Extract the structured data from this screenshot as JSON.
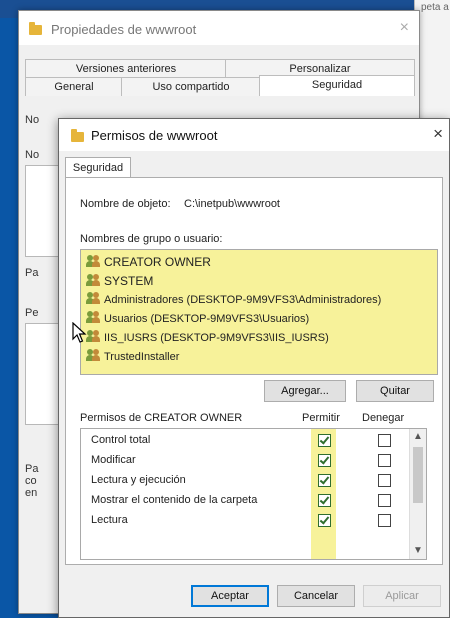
{
  "background": {
    "breadcrumb": "peta a"
  },
  "outer_window": {
    "title": "Propiedades de wwwroot",
    "close_glyph": "×",
    "tabs_row1": [
      "Versiones anteriores",
      "Personalizar"
    ],
    "tabs_row2": [
      "General",
      "Uso compartido",
      "Seguridad"
    ],
    "left_fragments": [
      "No",
      "No",
      "Pa",
      "Pe",
      "Pa",
      "co",
      "en"
    ]
  },
  "dialog": {
    "title": "Permisos de wwwroot",
    "close_glyph": "×",
    "tab": "Seguridad",
    "object_label": "Nombre de objeto:",
    "object_value": "C:\\inetpub\\wwwroot",
    "groups_label": "Nombres de grupo o usuario:",
    "groups": [
      "CREATOR OWNER",
      "SYSTEM",
      "Administradores (DESKTOP-9M9VFS3\\Administradores)",
      "Usuarios (DESKTOP-9M9VFS3\\Usuarios)",
      "IIS_IUSRS (DESKTOP-9M9VFS3\\IIS_IUSRS)",
      "TrustedInstaller"
    ],
    "add_button": "Agregar...",
    "remove_button": "Quitar",
    "permissions_label": "Permisos de CREATOR OWNER",
    "allow_header": "Permitir",
    "deny_header": "Denegar",
    "permissions": [
      {
        "name": "Control total",
        "allow": true,
        "deny": false
      },
      {
        "name": "Modificar",
        "allow": true,
        "deny": false
      },
      {
        "name": "Lectura y ejecución",
        "allow": true,
        "deny": false
      },
      {
        "name": "Mostrar el contenido de la carpeta",
        "allow": true,
        "deny": false
      },
      {
        "name": "Lectura",
        "allow": true,
        "deny": false
      }
    ],
    "ok_button": "Aceptar",
    "cancel_button": "Cancelar",
    "apply_button": "Aplicar"
  },
  "colors": {
    "highlight": "#f7f29a",
    "desktop": "#0a56a6",
    "accent": "#0078d7"
  }
}
